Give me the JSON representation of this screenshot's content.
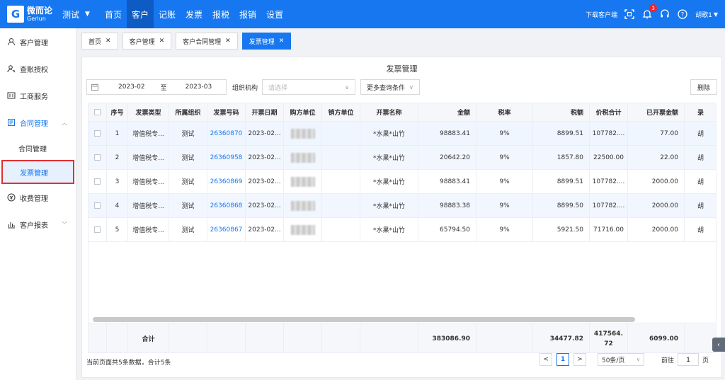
{
  "brand": {
    "cn": "微而论",
    "en": "Gerlun",
    "logo_letter": "G"
  },
  "tenant": "测试",
  "nav": [
    "首页",
    "客户",
    "记账",
    "发票",
    "报税",
    "报销",
    "设置"
  ],
  "nav_active": 1,
  "topright": {
    "download": "下载客户端",
    "notif_count": "3",
    "user": "胡歌1"
  },
  "sidebar": {
    "items": [
      {
        "label": "客户管理",
        "icon": "user-icon"
      },
      {
        "label": "查账授权",
        "icon": "user-key-icon"
      },
      {
        "label": "工商服务",
        "icon": "id-card-icon"
      },
      {
        "label": "合同管理",
        "icon": "contract-icon"
      },
      {
        "label": "收费管理",
        "icon": "money-icon"
      },
      {
        "label": "客户报表",
        "icon": "chart-icon"
      }
    ],
    "sub": [
      "合同管理",
      "发票管理"
    ]
  },
  "tabs": [
    "首页",
    "客户管理",
    "客户合同管理",
    "发票管理"
  ],
  "panel": {
    "title": "发票管理"
  },
  "filters": {
    "date_from": "2023-02",
    "date_sep": "至",
    "date_to": "2023-03",
    "org_label": "组织机构",
    "org_placeholder": "请选择",
    "more": "更多查询条件",
    "delete": "删除"
  },
  "columns": [
    "序号",
    "发票类型",
    "所属组织",
    "发票号码",
    "开票日期",
    "购方单位",
    "销方单位",
    "开票名称",
    "金额",
    "税率",
    "税额",
    "价税合计",
    "已开票金额",
    "录"
  ],
  "rows": [
    {
      "no": "1",
      "type": "增值税专...",
      "org": "测试",
      "num": "26360870",
      "date": "2023-02...",
      "name": "*水果*山竹",
      "amount": "98883.41",
      "rate": "9%",
      "tax": "8899.51",
      "total": "107782....",
      "invoiced": "77.00",
      "extra": "胡"
    },
    {
      "no": "2",
      "type": "增值税专...",
      "org": "测试",
      "num": "26360958",
      "date": "2023-02...",
      "name": "*水果*山竹",
      "amount": "20642.20",
      "rate": "9%",
      "tax": "1857.80",
      "total": "22500.00",
      "invoiced": "22.00",
      "extra": "胡"
    },
    {
      "no": "3",
      "type": "增值税专...",
      "org": "测试",
      "num": "26360869",
      "date": "2023-02...",
      "name": "*水果*山竹",
      "amount": "98883.41",
      "rate": "9%",
      "tax": "8899.51",
      "total": "107782....",
      "invoiced": "2000.00",
      "extra": "胡"
    },
    {
      "no": "4",
      "type": "增值税专...",
      "org": "测试",
      "num": "26360868",
      "date": "2023-02...",
      "name": "*水果*山竹",
      "amount": "98883.38",
      "rate": "9%",
      "tax": "8899.50",
      "total": "107782....",
      "invoiced": "2000.00",
      "extra": "胡"
    },
    {
      "no": "5",
      "type": "增值税专...",
      "org": "测试",
      "num": "26360867",
      "date": "2023-02...",
      "name": "*水果*山竹",
      "amount": "65794.50",
      "rate": "9%",
      "tax": "5921.50",
      "total": "71716.00",
      "invoiced": "2000.00",
      "extra": "胡"
    }
  ],
  "totals": {
    "label": "合计",
    "amount": "383086.90",
    "tax": "34477.82",
    "total": "417564.72",
    "invoiced": "6099.00"
  },
  "footer": {
    "info": "当前页面共5条数据，合计5条",
    "prev": "<",
    "page": "1",
    "next": ">",
    "page_size": "50条/页",
    "goto_label": "前往",
    "goto_value": "1",
    "goto_unit": "页"
  }
}
